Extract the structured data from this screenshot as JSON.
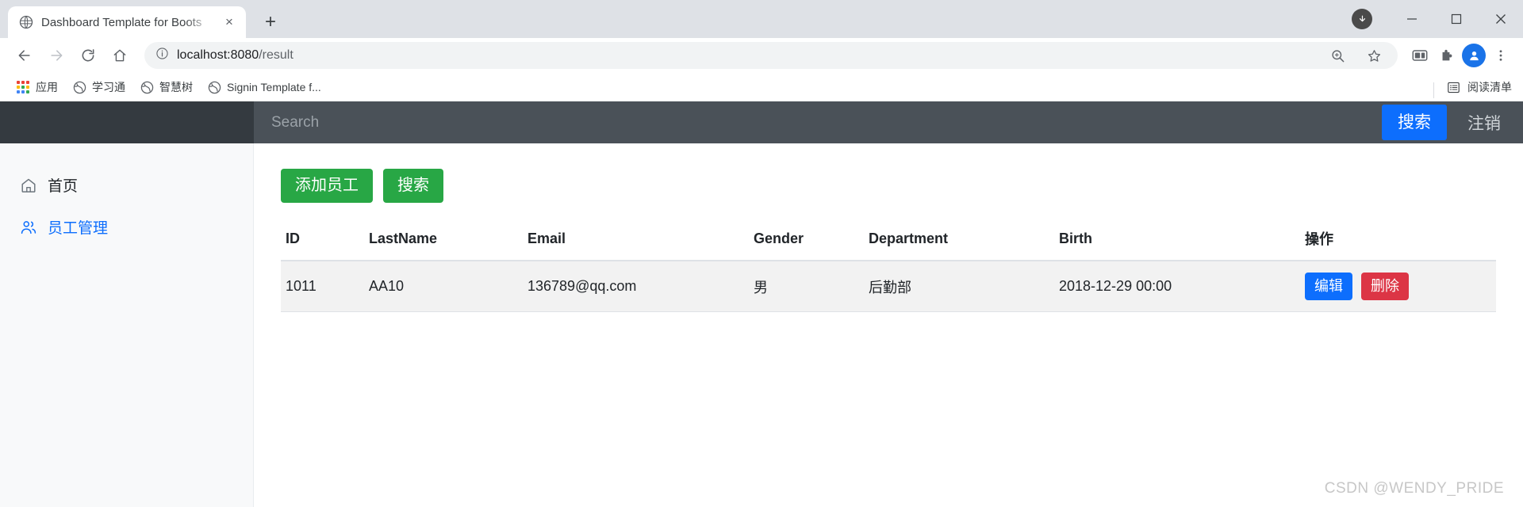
{
  "browser": {
    "tab": {
      "title": "Dashboard Template for Boots",
      "favicon": "globe-icon",
      "close": "×"
    },
    "new_tab_label": "+",
    "window_controls": {
      "minimize": "─",
      "maximize": "□",
      "close": "✕",
      "update_badge": "⬇"
    },
    "nav": {
      "back": "←",
      "forward": "→",
      "reload": "↻",
      "home": "⌂"
    },
    "omnibox": {
      "info_icon": "info-circle-icon",
      "host": "localhost:8080",
      "path": "/result",
      "zoom_icon": "zoom-icon",
      "star_icon": "star-icon",
      "media_icon": "media-icon",
      "extensions_icon": "puzzle-icon",
      "profile_icon": "profile-avatar-icon",
      "menu_icon": "kebab-menu-icon"
    },
    "bookmarks": [
      {
        "label": "应用",
        "icon": "apps-grid-icon"
      },
      {
        "label": "学习通",
        "icon": "globe-icon"
      },
      {
        "label": "智慧树",
        "icon": "globe-icon"
      },
      {
        "label": "Signin Template f...",
        "icon": "globe-icon"
      }
    ],
    "reading_list": {
      "label": "阅读清单",
      "icon": "reading-list-icon"
    }
  },
  "app": {
    "topnav": {
      "brand": "",
      "search_placeholder": "Search",
      "search_value": "",
      "search_button": "搜索",
      "logout": "注销"
    },
    "sidebar": {
      "items": [
        {
          "label": "首页",
          "icon": "home-icon",
          "active": false
        },
        {
          "label": "员工管理",
          "icon": "people-icon",
          "active": true
        }
      ]
    },
    "toolbar": {
      "add_employee": "添加员工",
      "search": "搜索"
    },
    "table": {
      "columns": [
        "ID",
        "LastName",
        "Email",
        "Gender",
        "Department",
        "Birth",
        "操作"
      ],
      "rows": [
        {
          "id": "1011",
          "last_name": "AA10",
          "email": "136789@qq.com",
          "gender": "男",
          "department": "后勤部",
          "birth": "2018-12-29 00:00",
          "actions": {
            "edit": "编辑",
            "delete": "删除"
          }
        }
      ]
    },
    "watermark": "CSDN @WENDY_PRIDE",
    "colors": {
      "navbar": "#4a5158",
      "brand_block": "#343a40",
      "primary": "#0d6efd",
      "success": "#28a745",
      "danger": "#dc3545",
      "sidebar_bg": "#f8f9fa"
    }
  }
}
